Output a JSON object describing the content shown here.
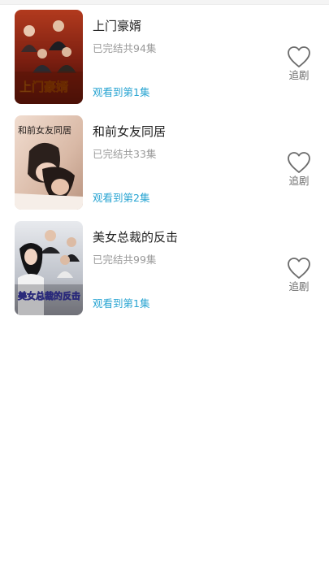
{
  "dramas": [
    {
      "title": "上门豪婿",
      "status": "已完结共94集",
      "progress": "观看到第1集",
      "follow_label": "追剧",
      "poster_text": "上门豪婿",
      "poster_icon": "poster-image"
    },
    {
      "title": "和前女友同居",
      "status": "已完结共33集",
      "progress": "观看到第2集",
      "follow_label": "追剧",
      "poster_text": "和前女友同居",
      "poster_icon": "poster-image"
    },
    {
      "title": "美女总裁的反击",
      "status": "已完结共99集",
      "progress": "观看到第1集",
      "follow_label": "追剧",
      "poster_text": "美女总裁的反击",
      "poster_icon": "poster-image"
    }
  ],
  "colors": {
    "accent": "#28a4d2",
    "title": "#222222",
    "muted": "#9a9a9a",
    "icon": "#6c6c6c"
  }
}
